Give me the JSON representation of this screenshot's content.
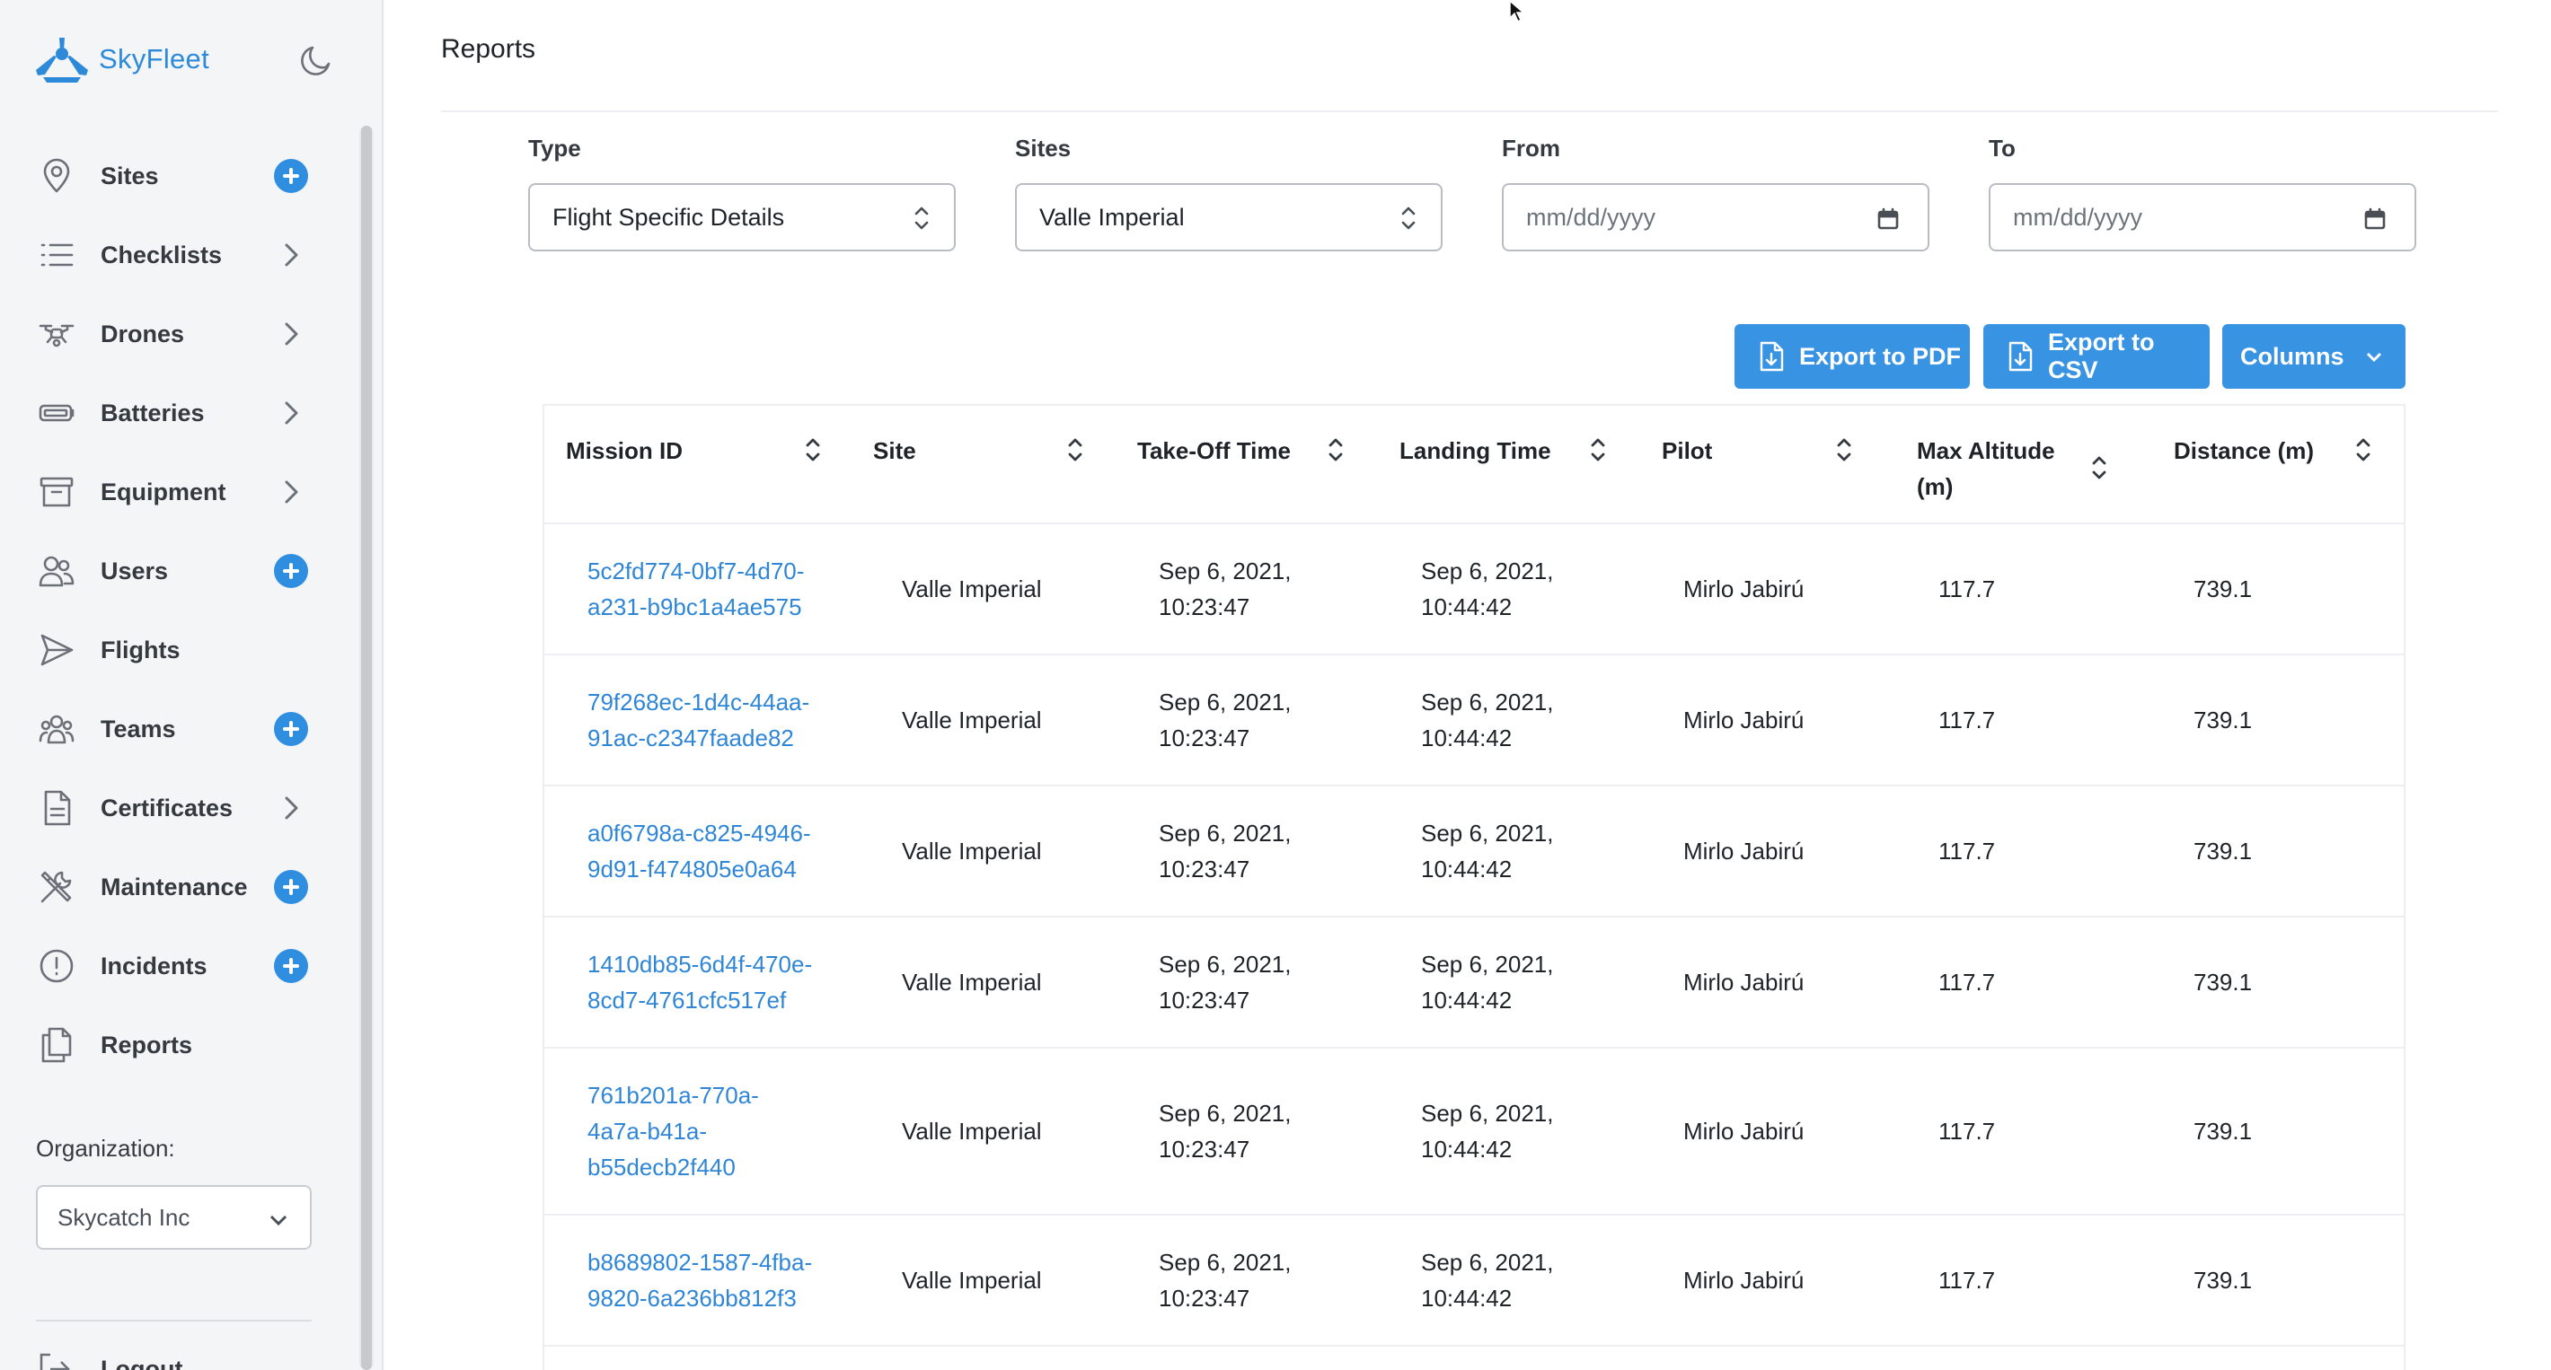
{
  "brand": {
    "name": "SkyFleet"
  },
  "colors": {
    "accent": "#2f8ee0",
    "button": "#3993e3",
    "link": "#2f86d6",
    "sidebar_bg": "#f4f5f7"
  },
  "sidebar": {
    "items": [
      {
        "label": "Sites",
        "icon": "map-pin-icon",
        "action": "plus"
      },
      {
        "label": "Checklists",
        "icon": "list-icon",
        "action": "chevron"
      },
      {
        "label": "Drones",
        "icon": "drone-icon",
        "action": "chevron"
      },
      {
        "label": "Batteries",
        "icon": "battery-icon",
        "action": "chevron"
      },
      {
        "label": "Equipment",
        "icon": "archive-box-icon",
        "action": "chevron"
      },
      {
        "label": "Users",
        "icon": "users-icon",
        "action": "plus"
      },
      {
        "label": "Flights",
        "icon": "send-icon",
        "action": "none"
      },
      {
        "label": "Teams",
        "icon": "team-icon",
        "action": "plus"
      },
      {
        "label": "Certificates",
        "icon": "document-icon",
        "action": "chevron"
      },
      {
        "label": "Maintenance",
        "icon": "tools-icon",
        "action": "plus"
      },
      {
        "label": "Incidents",
        "icon": "alert-circle-icon",
        "action": "plus"
      },
      {
        "label": "Reports",
        "icon": "files-icon",
        "action": "none"
      }
    ],
    "organization_label": "Organization:",
    "organization_value": "Skycatch Inc",
    "logout_label": "Logout"
  },
  "page": {
    "title": "Reports"
  },
  "filters": {
    "type": {
      "label": "Type",
      "value": "Flight Specific Details"
    },
    "sites": {
      "label": "Sites",
      "value": "Valle Imperial"
    },
    "from": {
      "label": "From",
      "placeholder": "mm/dd/yyyy"
    },
    "to": {
      "label": "To",
      "placeholder": "mm/dd/yyyy"
    }
  },
  "actions": {
    "export_pdf": "Export to PDF",
    "export_csv": "Export to CSV",
    "columns": "Columns"
  },
  "table": {
    "headers": [
      "Mission ID",
      "Site",
      "Take-Off Time",
      "Landing Time",
      "Pilot",
      "Max Altitude (m)",
      "Distance (m)"
    ],
    "rows": [
      {
        "id_lines": [
          "5c2fd774-0bf7-4d70-",
          "a231-b9bc1a4ae575"
        ],
        "site": "Valle Imperial",
        "takeoff": [
          "Sep 6, 2021,",
          "10:23:47"
        ],
        "landing": [
          "Sep 6, 2021,",
          "10:44:42"
        ],
        "pilot": "Mirlo Jabirú",
        "altitude": "117.7",
        "distance": "739.1"
      },
      {
        "id_lines": [
          "79f268ec-1d4c-44aa-",
          "91ac-c2347faade82"
        ],
        "site": "Valle Imperial",
        "takeoff": [
          "Sep 6, 2021,",
          "10:23:47"
        ],
        "landing": [
          "Sep 6, 2021,",
          "10:44:42"
        ],
        "pilot": "Mirlo Jabirú",
        "altitude": "117.7",
        "distance": "739.1"
      },
      {
        "id_lines": [
          "a0f6798a-c825-4946-",
          "9d91-f474805e0a64"
        ],
        "site": "Valle Imperial",
        "takeoff": [
          "Sep 6, 2021,",
          "10:23:47"
        ],
        "landing": [
          "Sep 6, 2021,",
          "10:44:42"
        ],
        "pilot": "Mirlo Jabirú",
        "altitude": "117.7",
        "distance": "739.1"
      },
      {
        "id_lines": [
          "1410db85-6d4f-470e-",
          "8cd7-4761cfc517ef"
        ],
        "site": "Valle Imperial",
        "takeoff": [
          "Sep 6, 2021,",
          "10:23:47"
        ],
        "landing": [
          "Sep 6, 2021,",
          "10:44:42"
        ],
        "pilot": "Mirlo Jabirú",
        "altitude": "117.7",
        "distance": "739.1"
      },
      {
        "id_lines": [
          "761b201a-770a-",
          "4a7a-b41a-",
          "b55decb2f440"
        ],
        "site": "Valle Imperial",
        "takeoff": [
          "Sep 6, 2021,",
          "10:23:47"
        ],
        "landing": [
          "Sep 6, 2021,",
          "10:44:42"
        ],
        "pilot": "Mirlo Jabirú",
        "altitude": "117.7",
        "distance": "739.1"
      },
      {
        "id_lines": [
          "b8689802-1587-4fba-",
          "9820-6a236bb812f3"
        ],
        "site": "Valle Imperial",
        "takeoff": [
          "Sep 6, 2021,",
          "10:23:47"
        ],
        "landing": [
          "Sep 6, 2021,",
          "10:44:42"
        ],
        "pilot": "Mirlo Jabirú",
        "altitude": "117.7",
        "distance": "739.1"
      }
    ]
  }
}
